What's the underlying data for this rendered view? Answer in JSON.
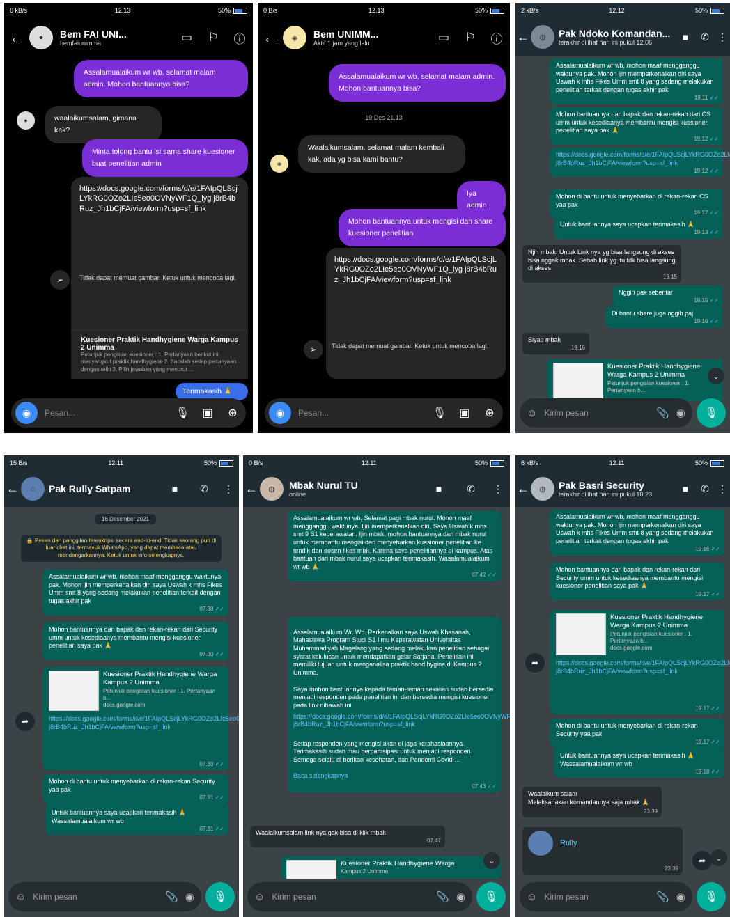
{
  "p1": {
    "status": {
      "left": "6 kB/s",
      "time": "12.13",
      "right": "50%"
    },
    "name": "Bem FAI UNI...",
    "sub": "bemfaiunimma",
    "m1": "Assalamualaikum wr wb, selamat malam admin. Mohon bantuannya bisa?",
    "m2": "waalaikumsalam, gimana kak?",
    "m3": "Minta tolong bantu isi sama share kuesioner buat penelitian admin",
    "url": "https://docs.google.com/forms/d/e/1FAIpQLScjLYkRG0OZo2LIe5eo0OVNyWF1Q_lyg j8rB4bRuz_Jh1bCjFA/viewform?usp=sf_link",
    "err": "Tidak dapat memuat gambar. Ketuk untuk mencoba lagi.",
    "card_t": "Kuesioner Praktik Handhygiene Warga Kampus 2 Unimma",
    "card_d": "Petunjuk pengisian kuesioner : 1. Pertanyaan berikut ini menyangkut praktik handhygiene 2. Bacalah setiap pertanyaan dengan teliti 3. Pilih jawaban yang menurut ...",
    "m4": "Terimakasih 🙏",
    "input": "Pesan..."
  },
  "p2": {
    "status": {
      "left": "0 B/s",
      "time": "12.13",
      "right": "50%"
    },
    "name": "Bem UNIMM...",
    "sub": "Aktif 1 jam yang lalu",
    "m1": "Assalamualaikum wr wb, selamat malam admin. Mohon bantuannya bisa?",
    "date": "19 Des 21.13",
    "m2": "Waalaikumsalam, selamat malam kembali kak, ada yg bisa kami bantu?",
    "m3": "Iya admin",
    "m4": "Mohon bantuannya untuk mengisi dan share kuesioner penelitian",
    "url": "https://docs.google.com/forms/d/e/1FAIpQLScjLYkRG0OZo2LIe5eo0OVNyWF1Q_lyg j8rB4bRuz_Jh1bCjFA/viewform?usp=sf_link",
    "err": "Tidak dapat memuat gambar. Ketuk untuk mencoba lagi.",
    "input": "Pesan..."
  },
  "p3": {
    "status": {
      "left": "2 kB/s",
      "time": "12.12",
      "right": "50%"
    },
    "name": "Pak Ndoko Komandan...",
    "sub": "terakhir dilihat hari ini pukul 12.06",
    "m1": "Assalamualaikum wr wb, mohon maaf mengganggu waktunya pak. Mohon ijin memperkenalkan diri saya Uswah k mhs Fikes Umm smt 8 yang sedang melakukan penelitian terkait dengan tugas akhir pak",
    "t1": "19.11",
    "m2": "Mohon bantuannya dari bapak dan rekan-rekan dari CS umm untuk kesediaanya membantu mengisi kuesioner penelitian saya pak 🙏",
    "t2": "19.12",
    "m3": "https://docs.google.com/forms/d/e/1FAIpQLScjLYkRG0OZo2LIe5eo0OVNyWF1Q_lyg j8rB4bRuz_Jh1bCjFA/viewform?usp=sf_link",
    "t3": "19.12",
    "m4": "Mohon di bantu untuk menyebarkan di rekan-rekan CS yaa pak",
    "t4": "19.12",
    "m5": "Untuk bantuannya saya ucapkan terimakasih 🙏",
    "t5": "19.13",
    "m6": "Njih mbak. Untuk Link nya yg bisa langsung di akses bisa nggak mbak. Sebab link yg itu tdk bisa langsung di akses",
    "t6": "19.15",
    "m7": "Nggih pak sebentar",
    "t7": "19.15",
    "m8": "Di bantu share juga nggih paj",
    "t8": "19.16",
    "m9": "Siyap mbak",
    "t9": "19.16",
    "card_t": "Kuesioner Praktik Handhygiene Warga Kampus 2 Unimma",
    "card_d": "Petunjuk pengisian kuesioner : 1. Pertanyaan b...",
    "input": "Kirim pesan"
  },
  "p4": {
    "status": {
      "left": "15 B/s",
      "time": "12.11",
      "right": "50%"
    },
    "name": "Pak Rully Satpam",
    "date": "16 Desember 2021",
    "notice": "🔒 Pesan dan panggilan terenkripsi secara end-to-end. Tidak seorang pun di luar chat ini, termasuk WhatsApp, yang dapat membaca atau mendengarkannya. Ketuk untuk info selengkapnya.",
    "m1": "Assalamualaikum wr wb, mohon maaf mengganggu waktunya pak. Mohon ijin memperkenalkan diri saya Uswah k mhs Fikes Umm smt 8 yang sedang melakukan penelitian terkait dengan tugas akhir pak",
    "t1": "07.30",
    "m2": "Mohon bantuannya dari bapak dan rekan-rekan dari Security umm untuk kesediaanya membantu mengisi kuesioner penelitian saya pak 🙏",
    "t2": "07.30",
    "card_t": "Kuesioner Praktik Handhygiene Warga Kampus 2 Unimma",
    "card_d": "Petunjuk pengisian kuesioner : 1. Pertanyaan b...",
    "card_s": "docs.google.com",
    "m3": "https://docs.google.com/forms/d/e/1FAIpQLScjLYkRG0OZo2LIe5eo0OVNyWF1Q_lyg j8rB4bRuz_Jh1bCjFA/viewform?usp=sf_link",
    "t3": "07.30",
    "m4": "Mohon di bantu untuk menyebarkan di rekan-rekan Security yaa pak",
    "t4": "07.31",
    "m5": "Untuk bantuannya saya ucapkan terimakasih 🙏\nWassalamualaikum wr wb",
    "t5": "07.31",
    "input": "Kirim pesan"
  },
  "p5": {
    "status": {
      "left": "0 B/s",
      "time": "12.11",
      "right": "50%"
    },
    "name": "Mbak Nurul TU",
    "sub": "online",
    "m1": "Assalamualaikum wr wb, Selamat pagi mbak nurul. Mohon maaf mengganggu waktunya. Ijin memperkenalkan diri, Saya Uswah k mhs smt 9 S1 keperawatan. Ijin mbak, mohon bantuannya dari mbak nurul untuk membantu mengisi dan menyebarkan kuesioner penelitian ke tendik dan dosen fikes mbk. Karena saya penelitiannya di kampus. Atas bantuan dari mbak nurul saya ucapkan terimakasih. Wasalamualaikum wr wb 🙏",
    "t1": "07.42",
    "m2": "Assalamualaikum Wr. Wb. Perkenalkan saya Uswah Khasanah, Mahasiswa Program Studi S1 Ilmu Keperawatan Universitas Muhammadiyah Magelang yang sedang melakukan penelitian sebagai syarat kelulusan untuk mendapatkan gelar Sarjana. Penelitian ini memiliki tujuan untuk menganalisa praktik hand hygine di Kampus 2 Unimma.\n\nSaya mohon bantuannya kepada teman-teman sekalian sudah bersedia menjadi responden pada penelitian ini dan bersedia mengisi kuesioner pada link dibawah ini",
    "m2link": "https://docs.google.com/forms/d/e/1FAIpQLScjLYkRG0OZo2LIe5eo0OVNyWF1Q_lyg j8rB4bRuz_Jh1bCjFA/viewform?usp=sf_link",
    "m2b": "Setiap responden yang mengisi akan di jaga kerahasiaannya. Terimakasih sudah mau berpartisipasi untuk menjadi responden. Semoga selalu di berikan kesehatan, dan Pandemi Covid-...",
    "m2more": "Baca selengkapnya",
    "t2": "07.43",
    "m3": "Waalaikumsalam link nya gak bisa di klik mbak",
    "t3": "07.47",
    "card_t": "Kuesioner Praktik Handhygiene Warga",
    "card_d": "Kampus 2 Unimma",
    "input": "Kirim pesan"
  },
  "p6": {
    "status": {
      "left": "6 kB/s",
      "time": "12.11",
      "right": "50%"
    },
    "name": "Pak Basri Security",
    "sub": "terakhir dilihat hari ini pukul 10.23",
    "m1": "Assalamualaikum wr wb, mohon maaf mengganggu waktunya pak. Mohon ijin memperkenalkan diri saya Uswah k mhs Fikes Umm smt 8 yang sedang melakukan penelitian terkait dengan tugas akhir pak",
    "t1": "19.16",
    "m2": "Mohon bantuannya dari bapak dan rekan-rekan dari Security umm untuk kesediaanya membantu mengisi kuesioner penelitian saya pak 🙏",
    "t2": "19.17",
    "card_t": "Kuesioner Praktik Handhygiene Warga Kampus 2 Unimma",
    "card_d": "Petunjuk pengisian kuesioner : 1. Pertanyaan b...",
    "card_s": "docs.google.com",
    "m3": "https://docs.google.com/forms/d/e/1FAIpQLScjLYkRG0OZo2LIe5eo0OVNyWF1Q_lyg j8rB4bRuz_Jh1bCjFA/viewform?usp=sf_link",
    "t3": "19.17",
    "m4": "Mohon di bantu untuk menyebarkan di rekan-rekan Security yaa pak",
    "t4": "19.17",
    "m5": "Untuk bantuannya saya ucapkan terimakasih 🙏\nWassalamualaikum wr wb",
    "t5": "19.18",
    "m6": "Waalaikum salam\nMelaksanakan komandannya saja mbak 🙏",
    "t6": "23.39",
    "m7": "Rully",
    "t7": "23.39",
    "input": "Kirim pesan"
  }
}
